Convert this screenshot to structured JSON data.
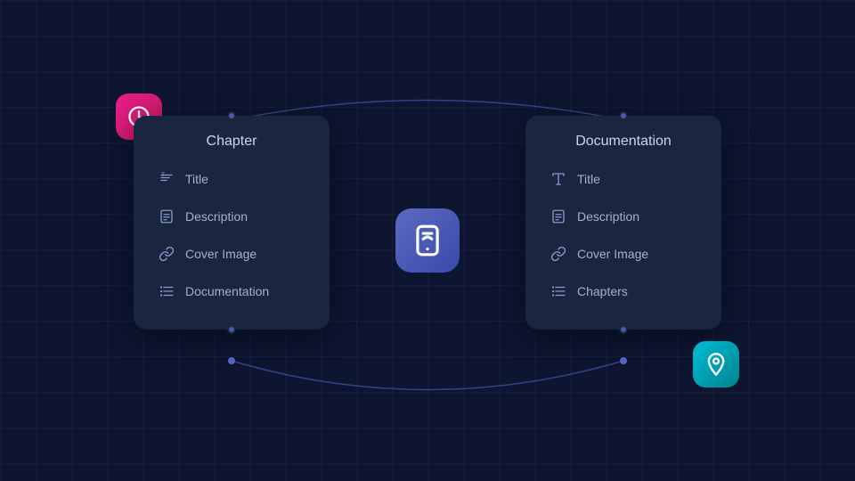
{
  "background": {
    "color": "#0d1530",
    "grid_color": "rgba(100,120,200,0.08)"
  },
  "chapter_card": {
    "title": "Chapter",
    "fields": [
      {
        "id": "title",
        "label": "Title",
        "icon": "text"
      },
      {
        "id": "description",
        "label": "Description",
        "icon": "doc"
      },
      {
        "id": "cover_image",
        "label": "Cover Image",
        "icon": "link"
      },
      {
        "id": "documentation",
        "label": "Documentation",
        "icon": "list"
      }
    ]
  },
  "documentation_card": {
    "title": "Documentation",
    "fields": [
      {
        "id": "title",
        "label": "Title",
        "icon": "text"
      },
      {
        "id": "description",
        "label": "Description",
        "icon": "doc"
      },
      {
        "id": "cover_image",
        "label": "Cover Image",
        "icon": "link"
      },
      {
        "id": "chapters",
        "label": "Chapters",
        "icon": "list"
      }
    ]
  },
  "badges": {
    "clock": {
      "color": "#e91e8c",
      "icon": "clock"
    },
    "phone": {
      "color": "#5c6bc0",
      "icon": "phone"
    },
    "pin": {
      "color": "#00bcd4",
      "icon": "pin"
    }
  }
}
